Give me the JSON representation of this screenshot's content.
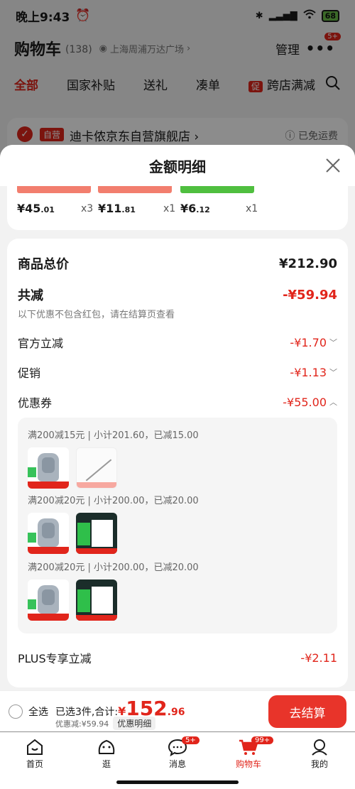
{
  "status_bar": {
    "time": "晚上9:43",
    "battery": "68"
  },
  "cart_header": {
    "title": "购物车",
    "count": "(138)",
    "location": "上海周浦万达广场",
    "manage": "管理",
    "more_badge": "5+"
  },
  "tabs": [
    {
      "label": "全部"
    },
    {
      "label": "国家补贴"
    },
    {
      "label": "送礼"
    },
    {
      "label": "凑单"
    },
    {
      "label": "跨店满减",
      "mark": "促"
    }
  ],
  "store": {
    "self_tag": "自营",
    "name": "迪卡侬京东自营旗舰店 ›",
    "shipping": "已免运费"
  },
  "sheet": {
    "title": "金额明细",
    "goods": [
      {
        "price_int": "¥45",
        "price_dec": ".01",
        "qty": "x3"
      },
      {
        "price_int": "¥11",
        "price_dec": ".81",
        "qty": "x1"
      },
      {
        "price_int": "¥6",
        "price_dec": ".12",
        "qty": "x1"
      }
    ],
    "total_label": "商品总价",
    "total_value": "¥212.90",
    "reduce_label": "共减",
    "reduce_value": "-¥59.94",
    "reduce_note": "以下优惠不包含红包，请在结算页查看",
    "official_label": "官方立减",
    "official_value": "-¥1.70",
    "promo_label": "促销",
    "promo_value": "-¥1.13",
    "coupon_label": "优惠券",
    "coupon_value": "-¥55.00",
    "coupons": [
      {
        "text": "满200减15元 | 小计201.60，已减15.00"
      },
      {
        "text": "满200减20元 | 小计200.00，已减20.00"
      },
      {
        "text": "满200减20元 | 小计200.00，已减20.00"
      }
    ],
    "plus_label": "PLUS专享立减",
    "plus_value": "-¥2.11"
  },
  "checkout": {
    "select_all": "全选",
    "selected_text": "已选3件,合计:",
    "currency": "¥",
    "amount_int": "152",
    "amount_dec": ".96",
    "saved": "优惠减:¥59.94",
    "detail_button": "优惠明细",
    "checkout_button": "去结算"
  },
  "nav": [
    {
      "label": "首页"
    },
    {
      "label": "逛"
    },
    {
      "label": "消息",
      "badge": "5+"
    },
    {
      "label": "购物车",
      "badge": "99+"
    },
    {
      "label": "我的"
    }
  ],
  "colors": {
    "accent": "#e1251b",
    "checkout_button": "#e8342a"
  }
}
